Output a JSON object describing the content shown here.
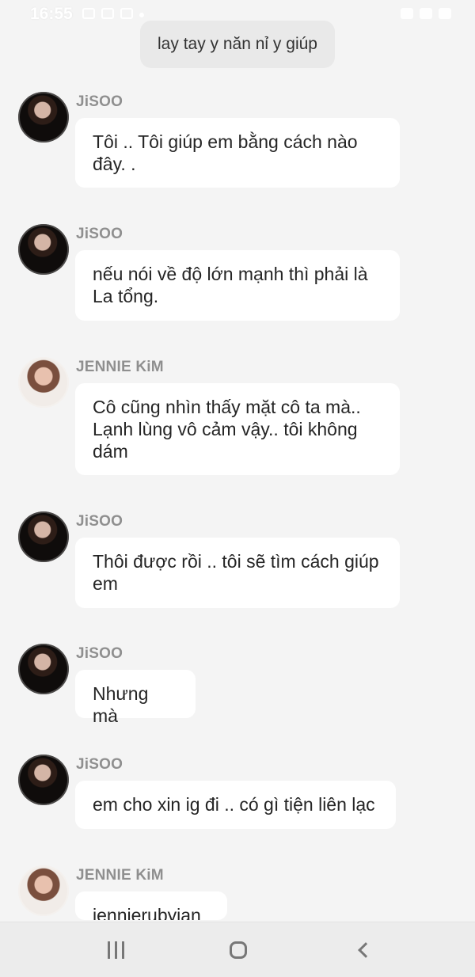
{
  "status_bar": {
    "time": "16:55"
  },
  "system_message": "lay tay y năn nỉ y giúp",
  "messages": [
    {
      "sender": "JiSOO",
      "avatar": "jisoo",
      "text": "Tôi .. Tôi giúp em bằng cách nào\nđây. ."
    },
    {
      "sender": "JiSOO",
      "avatar": "jisoo",
      "text": "nếu nói về độ lớn mạnh thì phải là\nLa tổng."
    },
    {
      "sender": "JENNIE KiM",
      "avatar": "jennie",
      "text": "Cô cũng nhìn thấy mặt cô ta mà..\nLạnh lùng vô cảm vậy.. tôi không\ndám"
    },
    {
      "sender": "JiSOO",
      "avatar": "jisoo",
      "text": "Thôi được rồi .. tôi sẽ tìm cách giúp\nem"
    },
    {
      "sender": "JiSOO",
      "avatar": "jisoo",
      "text": "Nhưng mà"
    },
    {
      "sender": "JiSOO",
      "avatar": "jisoo",
      "text": "em cho xin ig đi .. có gì tiện liên lạc"
    },
    {
      "sender": "JENNIE KiM",
      "avatar": "jennie",
      "text": "jennierubyjane"
    }
  ],
  "navigation": {
    "recent_label": "Recent apps",
    "home_label": "Home",
    "back_label": "Back"
  }
}
